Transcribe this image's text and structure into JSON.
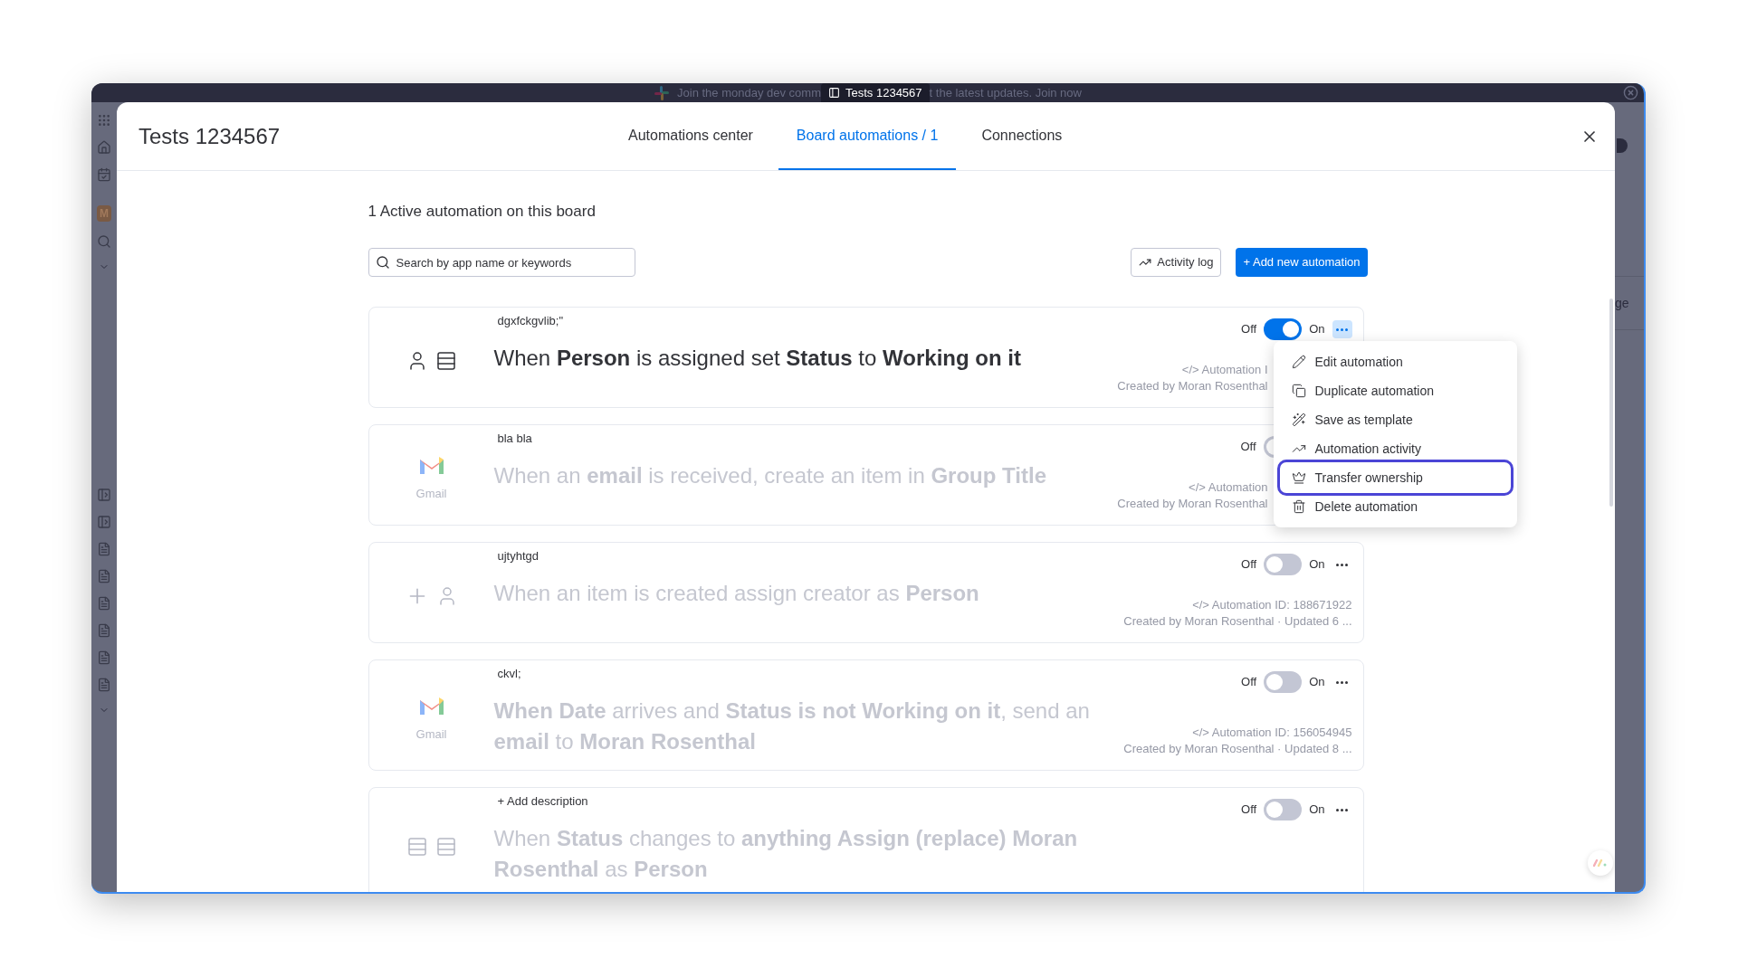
{
  "window": {
    "banner": [
      "Join the monday dev comm",
      "t the latest updates. Join now"
    ],
    "tab_title": "Tests 1234567",
    "workspace_initial": "M",
    "side_text": "ge"
  },
  "modal": {
    "title": "Tests 1234567",
    "tabs": [
      {
        "label": "Automations center",
        "selected": false
      },
      {
        "label": "Board automations / 1",
        "selected": true
      },
      {
        "label": "Connections",
        "selected": false
      }
    ]
  },
  "summary": "1 Active automation on this board",
  "search": {
    "placeholder": "Search by app name or keywords"
  },
  "actions": [
    {
      "kind": "secondary",
      "label": "Activity log"
    },
    {
      "kind": "primary",
      "label": "+ Add new automation"
    }
  ],
  "automations": [
    {
      "name": "dgxfckgvlib;\"",
      "icons": [
        {
          "kind": "person"
        },
        {
          "kind": "table"
        }
      ],
      "sentence": "When **Person** is assigned set **Status** to **Working on it**",
      "on": true,
      "off_label": "Off",
      "on_label": "On",
      "more": true,
      "more_active": true,
      "meta": [
        "</> Automation I",
        "Created by Moran Rosenthal"
      ]
    },
    {
      "name": "bla bla",
      "icons": [
        {
          "kind": "gmail"
        }
      ],
      "app_label": "Gmail",
      "sentence": "When an **email** is received, create an item in **Group Title**",
      "on": false,
      "off_label": "Off",
      "more": false,
      "more_active": false,
      "meta": [
        "</> Automation",
        "Created by Moran Rosenthal"
      ]
    },
    {
      "name": "ujtyhtgd",
      "icons": [
        {
          "kind": "plus"
        },
        {
          "kind": "person"
        }
      ],
      "sentence": "When an item is created assign creator as **Person**",
      "on": false,
      "off_label": "Off",
      "on_label": "On",
      "more": true,
      "more_active": false,
      "meta": [
        "</> Automation ID: 188671922",
        "Created by Moran Rosenthal · Updated 6 ..."
      ]
    },
    {
      "name": "ckvl;",
      "icons": [
        {
          "kind": "gmail"
        }
      ],
      "app_label": "Gmail",
      "sentence": "**When Date** arrives and **Status is not Working on it**, send an **email** to **Moran Rosenthal**",
      "on": false,
      "off_label": "Off",
      "on_label": "On",
      "more": true,
      "more_active": false,
      "meta": [
        "</> Automation ID: 156054945",
        "Created by Moran Rosenthal · Updated 8 ..."
      ]
    },
    {
      "name": "+ Add description",
      "icons": [
        {
          "kind": "table"
        },
        {
          "kind": "table"
        }
      ],
      "sentence": "When **Status** changes to **anything Assign (replace) Moran Rosenthal** as **Person**",
      "on": false,
      "off_label": "Off",
      "on_label": "On",
      "more": true,
      "more_active": false
    }
  ],
  "menu": {
    "items": [
      {
        "kind": "edit",
        "label": "Edit automation",
        "selected": false
      },
      {
        "kind": "duplicate",
        "label": "Duplicate automation",
        "selected": false
      },
      {
        "kind": "template",
        "label": "Save as template",
        "selected": false
      },
      {
        "kind": "activity",
        "label": "Automation activity",
        "selected": false
      },
      {
        "kind": "transfer",
        "label": "Transfer ownership",
        "selected": true
      },
      {
        "kind": "delete",
        "label": "Delete automation",
        "selected": false
      }
    ]
  }
}
